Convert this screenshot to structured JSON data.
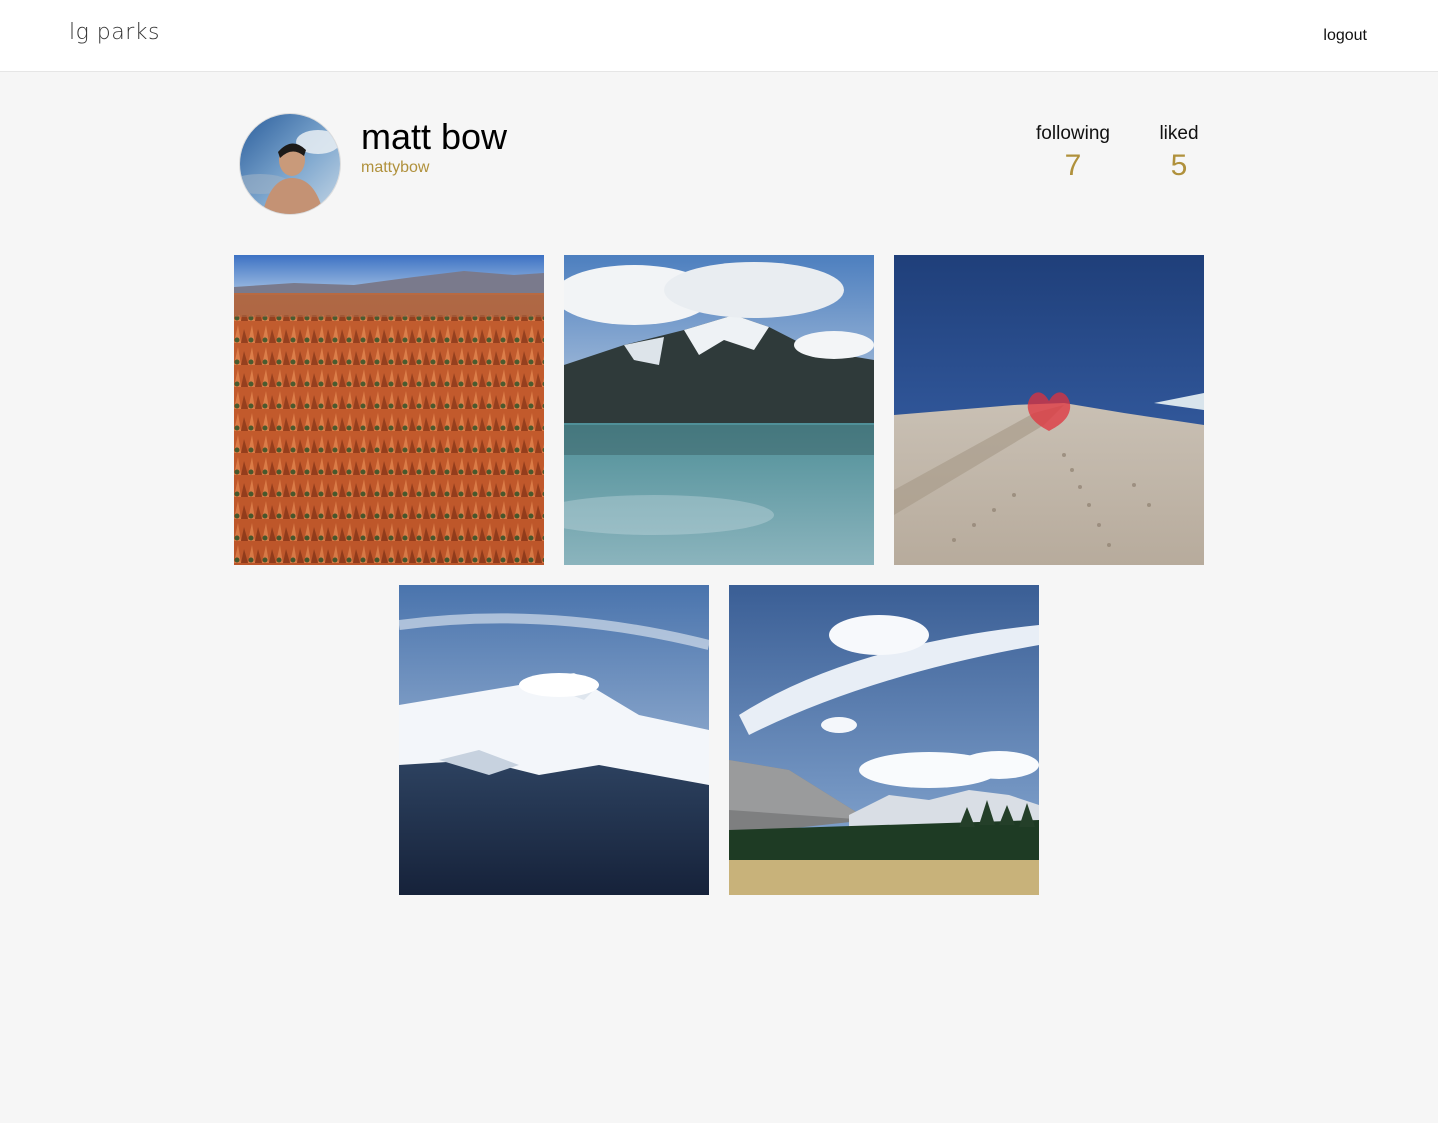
{
  "header": {
    "logo": "lg parks",
    "logout_label": "logout"
  },
  "profile": {
    "name": "matt bow",
    "username": "mattybow",
    "stats": {
      "following_label": "following",
      "following_count": "7",
      "liked_label": "liked",
      "liked_count": "5"
    }
  },
  "colors": {
    "accent": "#b0913c",
    "background": "#f6f6f6",
    "header_bg": "#ffffff"
  },
  "photos": [
    {
      "subject": "canyon-hoodoos"
    },
    {
      "subject": "glacier-lake-mountain"
    },
    {
      "subject": "sand-dune-heart"
    },
    {
      "subject": "snowy-mountain"
    },
    {
      "subject": "meadow-clouds"
    }
  ]
}
